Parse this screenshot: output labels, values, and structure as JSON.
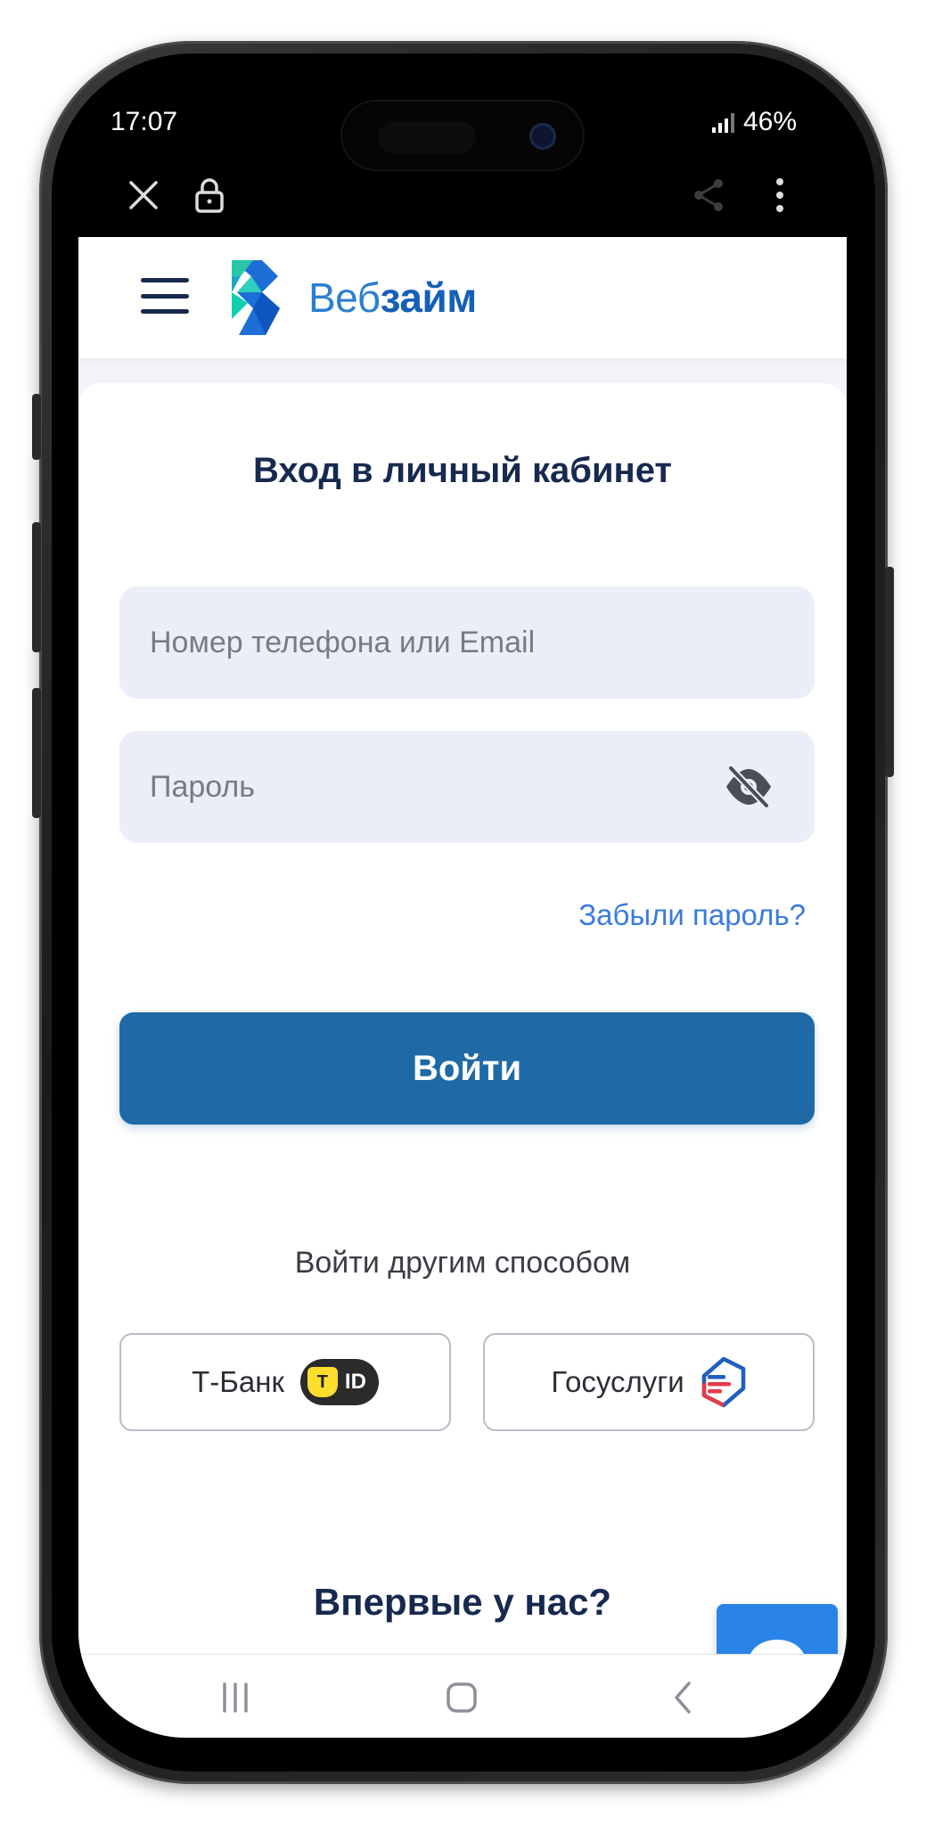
{
  "status_bar": {
    "time": "17:07",
    "battery": "46%"
  },
  "header": {
    "brand_part1": "Веб",
    "brand_part2": "займ"
  },
  "login": {
    "title": "Вход в личный кабинет",
    "phone_placeholder": "Номер телефона или Email",
    "password_placeholder": "Пароль",
    "forgot_link": "Забыли пароль?",
    "submit_label": "Войти"
  },
  "alt_login": {
    "title": "Войти другим способом",
    "tbank_label": "Т-Банк",
    "tbank_badge_mark": "T",
    "tbank_badge_id": "ID",
    "gosuslugi_label": "Госуслуги"
  },
  "signup": {
    "title": "Впервые у нас?"
  },
  "colors": {
    "primary": "#1f6aa6",
    "link": "#3a7be0",
    "title": "#17294f",
    "chat": "#2a84e8",
    "field_bg": "#eceef7"
  },
  "icons": [
    "close-icon",
    "lock-icon",
    "share-icon",
    "more-icon",
    "menu-icon",
    "eye-off-icon",
    "chat-icon",
    "recent-apps-icon",
    "home-icon",
    "back-icon"
  ]
}
